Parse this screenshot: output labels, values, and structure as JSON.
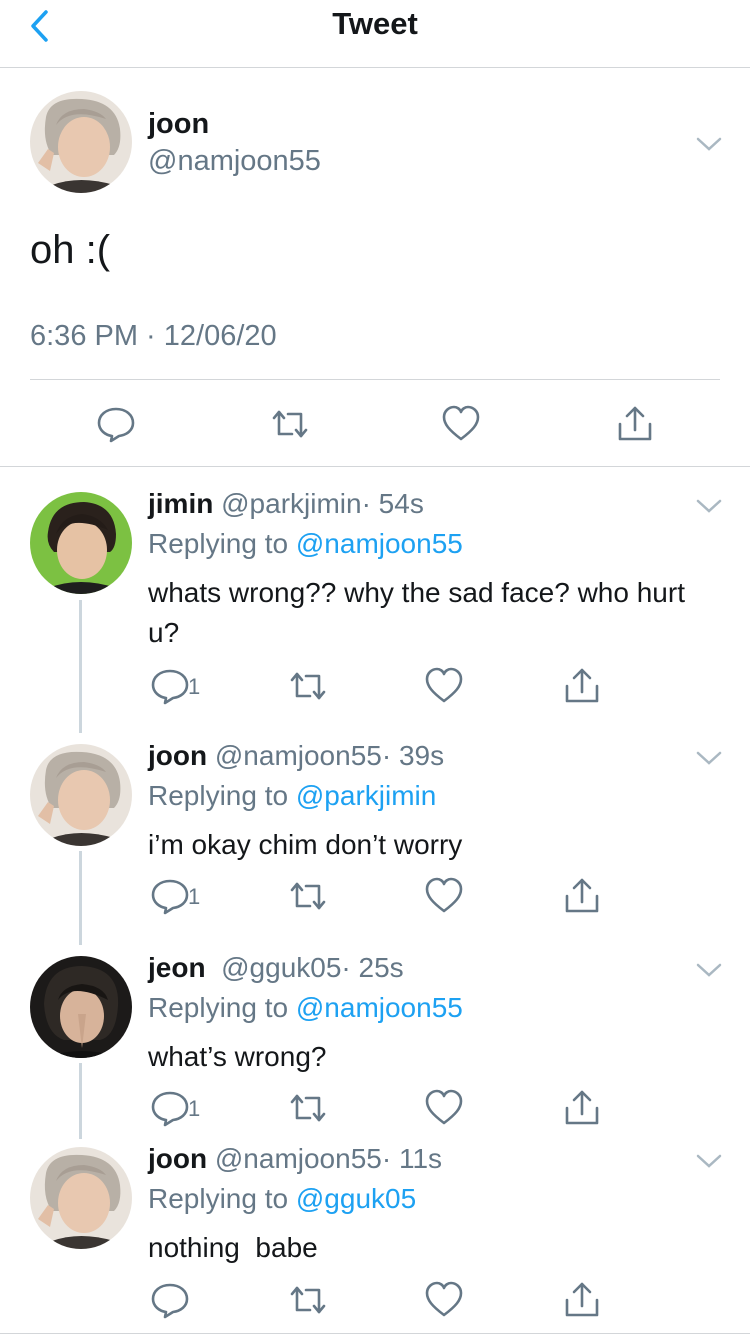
{
  "header": {
    "title": "Tweet",
    "back_icon": "chevron-left-icon"
  },
  "accent": "#1da1f2",
  "main_tweet": {
    "name": "joon",
    "handle": "@namjoon55",
    "text": "oh :(",
    "timestamp": "6:36 PM · 12/06/20"
  },
  "replies": [
    {
      "name": "jimin",
      "handle": "@parkjimin",
      "time": "· 54s",
      "replying_label": "Replying to",
      "replying_to": "@namjoon55",
      "text": "whats wrong?? why the sad face? who hurt u?",
      "reply_count": "1"
    },
    {
      "name": "joon",
      "handle": "@namjoon55",
      "time": "· 39s",
      "replying_label": "Replying to",
      "replying_to": "@parkjimin",
      "text": "i’m okay chim don’t worry",
      "reply_count": "1"
    },
    {
      "name": "jeon",
      "handle": "@gguk05",
      "time": "· 25s",
      "replying_label": "Replying to",
      "replying_to": "@namjoon55",
      "text": "what’s wrong?",
      "reply_count": "1"
    },
    {
      "name": "joon",
      "handle": "@namjoon55",
      "time": "· 11s",
      "replying_label": "Replying to",
      "replying_to": "@gguk05",
      "text": "nothing  babe",
      "reply_count": ""
    }
  ]
}
